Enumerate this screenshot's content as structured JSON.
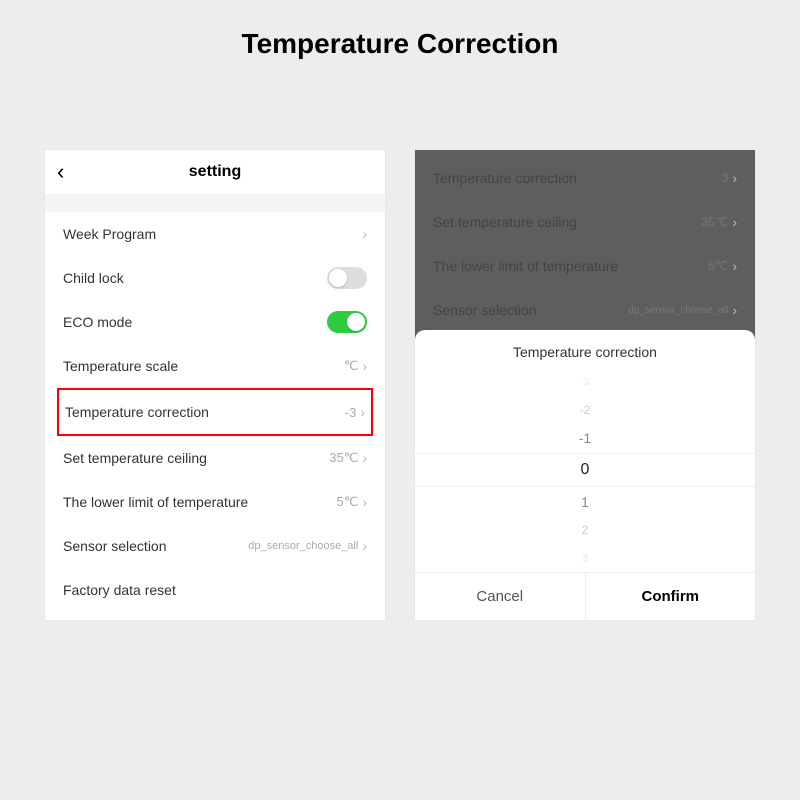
{
  "page_title": "Temperature Correction",
  "left": {
    "title": "setting",
    "rows": {
      "week_program": {
        "label": "Week Program"
      },
      "child_lock": {
        "label": "Child lock",
        "on": false
      },
      "eco_mode": {
        "label": "ECO mode",
        "on": true
      },
      "temp_scale": {
        "label": "Temperature scale",
        "value": "℃"
      },
      "temp_corr": {
        "label": "Temperature correction",
        "value": "-3"
      },
      "temp_ceiling": {
        "label": "Set temperature ceiling",
        "value": "35℃"
      },
      "temp_lower": {
        "label": "The lower limit of temperature",
        "value": "5℃"
      },
      "sensor_sel": {
        "label": "Sensor selection",
        "value": "dp_sensor_choose_all"
      },
      "factory_reset": {
        "label": "Factory data reset"
      }
    }
  },
  "right": {
    "dim_rows": {
      "temp_corr": {
        "label": "Temperature correction",
        "value": "-3"
      },
      "temp_ceiling": {
        "label": "Set temperature ceiling",
        "value": "35℃"
      },
      "temp_lower": {
        "label": "The lower limit of temperature",
        "value": "5℃"
      },
      "sensor_sel": {
        "label": "Sensor selection",
        "value": "dp_sensor_choose_all"
      }
    },
    "sheet": {
      "title": "Temperature correction",
      "wheel": [
        "-3",
        "-2",
        "-1",
        "0",
        "1",
        "2",
        "3"
      ],
      "cancel": "Cancel",
      "confirm": "Confirm"
    }
  }
}
